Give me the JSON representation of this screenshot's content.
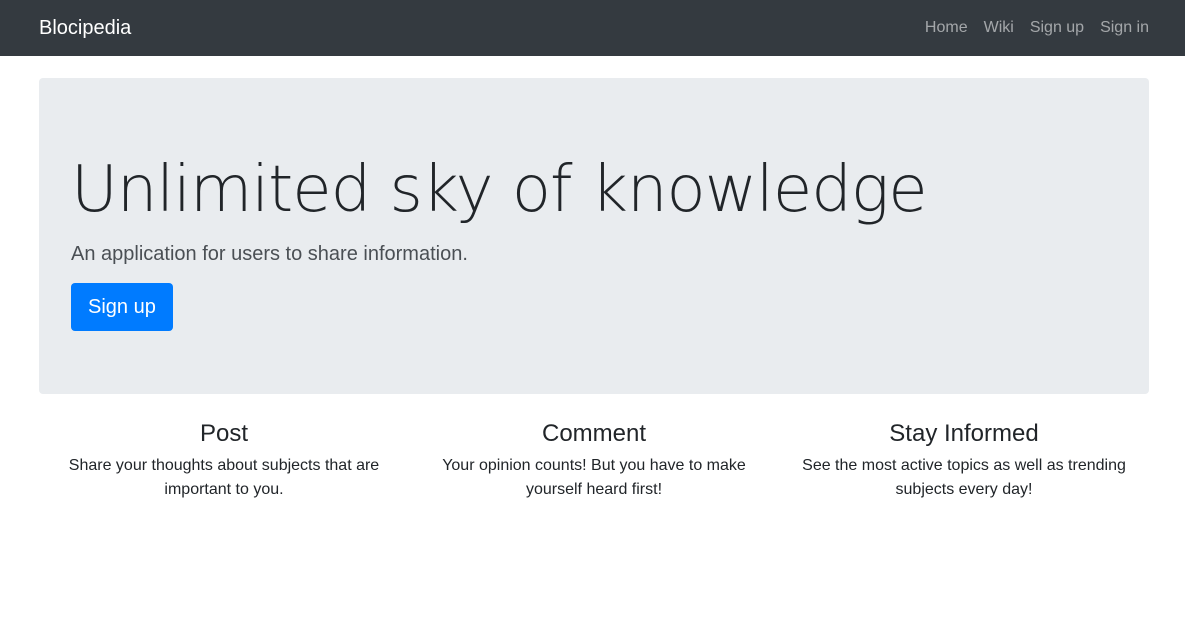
{
  "navbar": {
    "brand": "Blocipedia",
    "links": [
      {
        "label": "Home"
      },
      {
        "label": "Wiki"
      },
      {
        "label": "Sign up"
      },
      {
        "label": "Sign in"
      }
    ]
  },
  "hero": {
    "title": "Unlimited sky of knowledge",
    "lead": "An application for users to share information.",
    "button_label": "Sign up"
  },
  "features": [
    {
      "title": "Post",
      "text": "Share your thoughts about subjects that are important to you."
    },
    {
      "title": "Comment",
      "text": "Your opinion counts! But you have to make yourself heard first!"
    },
    {
      "title": "Stay Informed",
      "text": "See the most active topics as well as trending subjects every day!"
    }
  ],
  "colors": {
    "navbar_bg": "#343a40",
    "jumbotron_bg": "#e9ecef",
    "primary": "#007bff"
  }
}
